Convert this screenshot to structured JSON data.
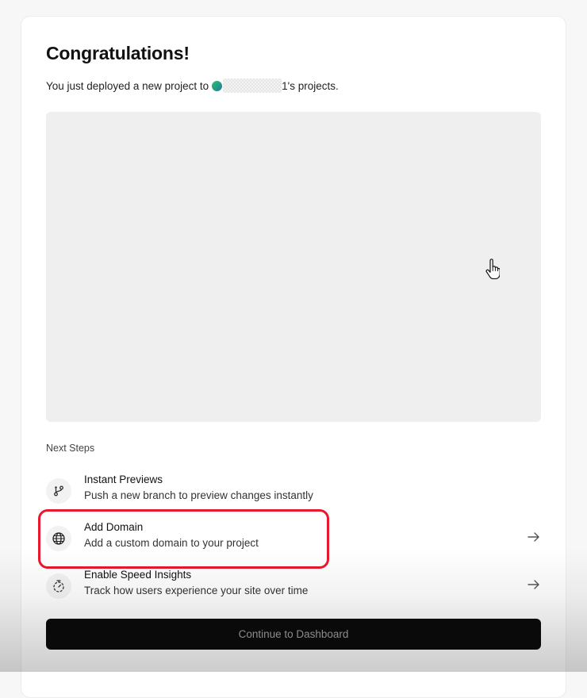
{
  "header": {
    "title": "Congratulations!",
    "subtitle_prefix": "You just deployed a new project to",
    "team_suffix": "1's projects."
  },
  "next_steps": {
    "label": "Next Steps",
    "items": [
      {
        "title": "Instant Previews",
        "description": "Push a new branch to preview changes instantly",
        "icon": "git-branch-icon"
      },
      {
        "title": "Add Domain",
        "description": "Add a custom domain to your project",
        "icon": "globe-icon"
      },
      {
        "title": "Enable Speed Insights",
        "description": "Track how users experience your site over time",
        "icon": "stopwatch-icon"
      }
    ]
  },
  "cta": {
    "label": "Continue to Dashboard"
  },
  "colors": {
    "highlight": "#e8192c",
    "cta_background": "#0a0a0a",
    "preview_background": "#efefef"
  }
}
